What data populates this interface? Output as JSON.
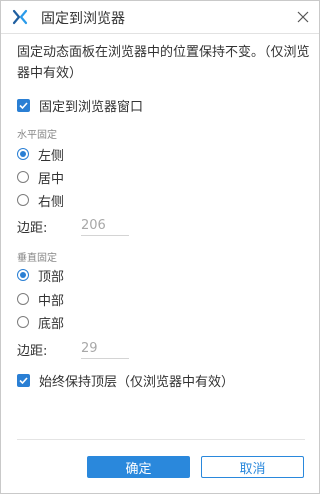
{
  "dialog": {
    "title": "固定到浏览器",
    "description": "固定动态面板在浏览器中的位置保持不变。（仅浏览器中有效）",
    "pin_to_browser": {
      "label": "固定到浏览器窗口",
      "checked": true
    },
    "horizontal": {
      "section_label": "水平固定",
      "options": [
        {
          "label": "左侧",
          "selected": true
        },
        {
          "label": "居中",
          "selected": false
        },
        {
          "label": "右侧",
          "selected": false
        }
      ],
      "margin_label": "边距:",
      "margin_value": "206"
    },
    "vertical": {
      "section_label": "垂直固定",
      "options": [
        {
          "label": "顶部",
          "selected": true
        },
        {
          "label": "中部",
          "selected": false
        },
        {
          "label": "底部",
          "selected": false
        }
      ],
      "margin_label": "边距:",
      "margin_value": "29"
    },
    "always_on_top": {
      "label": "始终保持顶层（仅浏览器中有效）",
      "checked": true
    },
    "buttons": {
      "ok": "确定",
      "cancel": "取消"
    }
  },
  "colors": {
    "accent": "#2a88dc",
    "checkbox": "#2a7fd4",
    "icon_bright": "#2a9bea",
    "icon_dark": "#1f5fa0"
  },
  "icons": {
    "app": "axure-x-icon",
    "close": "close-icon",
    "check": "checkmark-icon"
  }
}
